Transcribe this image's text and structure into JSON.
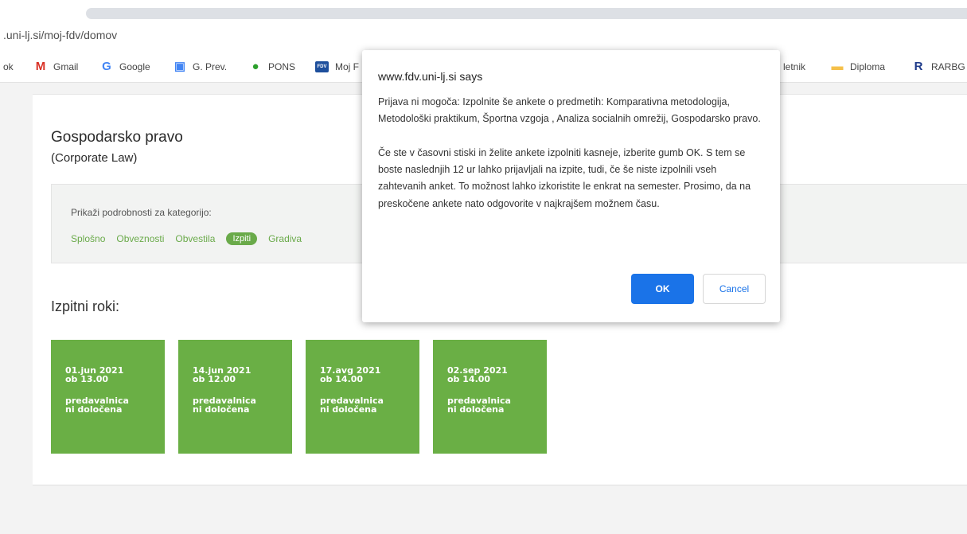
{
  "browser": {
    "url": ".uni-lj.si/moj-fdv/domov",
    "bookmarks": [
      {
        "label": "ok",
        "icon": "bookmark-truncated-icon"
      },
      {
        "label": "Gmail",
        "icon": "gmail-icon",
        "icon_glyph": "M",
        "color": "#d93025"
      },
      {
        "label": "Google",
        "icon": "google-icon",
        "icon_glyph": "G",
        "color": "#4285f4"
      },
      {
        "label": "G. Prev.",
        "icon": "google-translate-icon",
        "icon_glyph": "▣",
        "color": "#4285f4"
      },
      {
        "label": "PONS",
        "icon": "pons-icon",
        "icon_glyph": "●",
        "color": "#2ca02c"
      },
      {
        "label": "Moj F",
        "icon": "fdv-icon",
        "icon_glyph": "FDV",
        "color": "#1e4f9c"
      },
      {
        "label": "letnik",
        "icon": "folder-icon"
      },
      {
        "label": "Diploma",
        "icon": "folder-icon",
        "icon_glyph": "▬",
        "color": "#f5c04a"
      },
      {
        "label": "RARBG",
        "icon": "rarbg-icon",
        "icon_glyph": "R",
        "color": "#1e3a8a"
      }
    ]
  },
  "course": {
    "title": "Gospodarsko pravo",
    "subtitle": "(Corporate Law)"
  },
  "categories": {
    "label": "Prikaži podrobnosti za kategorijo:",
    "tabs": [
      {
        "label": "Splošno",
        "active": false
      },
      {
        "label": "Obveznosti",
        "active": false
      },
      {
        "label": "Obvestila",
        "active": false
      },
      {
        "label": "Izpiti",
        "active": true
      },
      {
        "label": "Gradiva",
        "active": false
      }
    ]
  },
  "exams": {
    "title": "Izpitni roki:",
    "slots": [
      {
        "date": "01.jun 2021",
        "time": "ob 13.00",
        "room1": "predavalnica",
        "room2": "ni določena"
      },
      {
        "date": "14.jun 2021",
        "time": "ob 12.00",
        "room1": "predavalnica",
        "room2": "ni določena"
      },
      {
        "date": "17.avg 2021",
        "time": "ob 14.00",
        "room1": "predavalnica",
        "room2": "ni določena"
      },
      {
        "date": "02.sep 2021",
        "time": "ob 14.00",
        "room1": "predavalnica",
        "room2": "ni določena"
      }
    ]
  },
  "dialog": {
    "title": "www.fdv.uni-lj.si says",
    "message": "Prijava ni mogoča: Izpolnite še ankete o predmetih: Komparativna metodologija, Metodološki praktikum, Športna vzgoja , Analiza socialnih omrežij, Gospodarsko pravo.\n\nČe ste v časovni stiski in želite ankete izpolniti kasneje, izberite gumb OK. S tem se boste naslednjih 12 ur lahko prijavljali na izpite, tudi, če še niste izpolnili vseh zahtevanih anket. To možnost lahko izkoristite le enkrat na semester. Prosimo, da na preskočene ankete nato odgovorite v najkrajšem možnem času.",
    "ok_label": "OK",
    "cancel_label": "Cancel"
  },
  "colors": {
    "accent_green": "#6aaf45",
    "dialog_blue": "#1a73e8"
  }
}
